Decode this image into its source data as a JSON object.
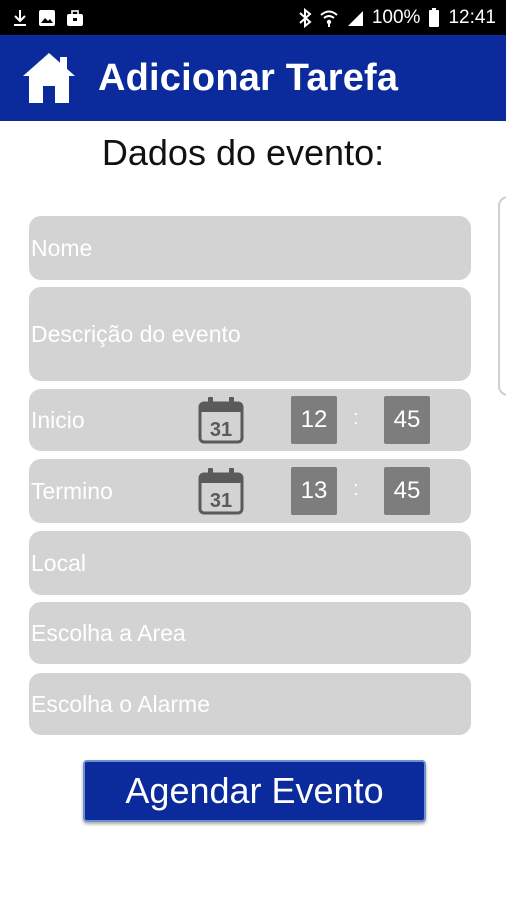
{
  "status_bar": {
    "battery": "100%",
    "time": "12:41",
    "left_icons": [
      "download-icon",
      "image-icon",
      "briefcase-icon"
    ],
    "right_icons": [
      "bluetooth-icon",
      "wifi-icon",
      "signal-icon",
      "battery-icon"
    ]
  },
  "app_bar": {
    "title": "Adicionar Tarefa",
    "icon": "home-icon"
  },
  "form": {
    "heading": "Dados do evento:",
    "nome_placeholder": "Nome",
    "descricao_placeholder": "Descrição do evento",
    "inicio": {
      "label": "Inicio",
      "calendar_day": "31",
      "hour": "12",
      "minute": "45"
    },
    "termino": {
      "label": "Termino",
      "calendar_day": "31",
      "hour": "13",
      "minute": "45"
    },
    "separator": ":",
    "local_placeholder": "Local",
    "area_placeholder": "Escolha a Area",
    "alarme_placeholder": "Escolha o Alarme",
    "submit_label": "Agendar Evento"
  },
  "colors": {
    "primary": "#0b2a9c",
    "field_background": "#d3d3d3",
    "time_box": "#7d7d7d"
  }
}
